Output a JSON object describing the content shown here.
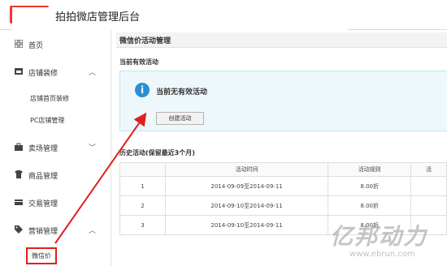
{
  "app": {
    "logo_text": "拍拍",
    "logo_sub": "微店管理",
    "title": "拍拍微店管理后台"
  },
  "sidebar": {
    "items": [
      {
        "label": "首页",
        "icon": "grid-icon"
      },
      {
        "label": "店铺装修",
        "icon": "store-icon",
        "chevron": "︿"
      },
      {
        "label": "卖场管理",
        "icon": "bag-icon",
        "chevron": "﹀"
      },
      {
        "label": "商品管理",
        "icon": "shirt-icon"
      },
      {
        "label": "交易管理",
        "icon": "card-icon"
      },
      {
        "label": "营销管理",
        "icon": "tag-icon",
        "chevron": "︿"
      }
    ],
    "sub_decor": [
      "店铺首页装修",
      "PC店铺管理"
    ],
    "sub_marketing": [
      "微信价"
    ]
  },
  "main": {
    "panel_title": "微信价活动管理",
    "active_label": "当前有效活动",
    "notice": {
      "icon": "info-icon",
      "text": "当前无有效活动",
      "button": "创建活动"
    },
    "history_label": "历史活动(保留最近3个月)",
    "table": {
      "headers": [
        "",
        "活动时间",
        "活动规则",
        "活"
      ],
      "rows": [
        [
          "1",
          "2014-09-09至2014-09-11",
          "8.00折",
          ""
        ],
        [
          "2",
          "2014-09-10至2014-09-11",
          "8.00折",
          ""
        ],
        [
          "3",
          "2014-09-10至2014-09-11",
          "8.00折",
          ""
        ]
      ]
    }
  },
  "watermark": {
    "text": "亿邦动力",
    "url": "www.ebrun.com"
  },
  "colors": {
    "brand": "#e8392f",
    "highlight": "#e0211a",
    "info": "#2d8fd3",
    "notice_bg": "#eef8fc"
  }
}
